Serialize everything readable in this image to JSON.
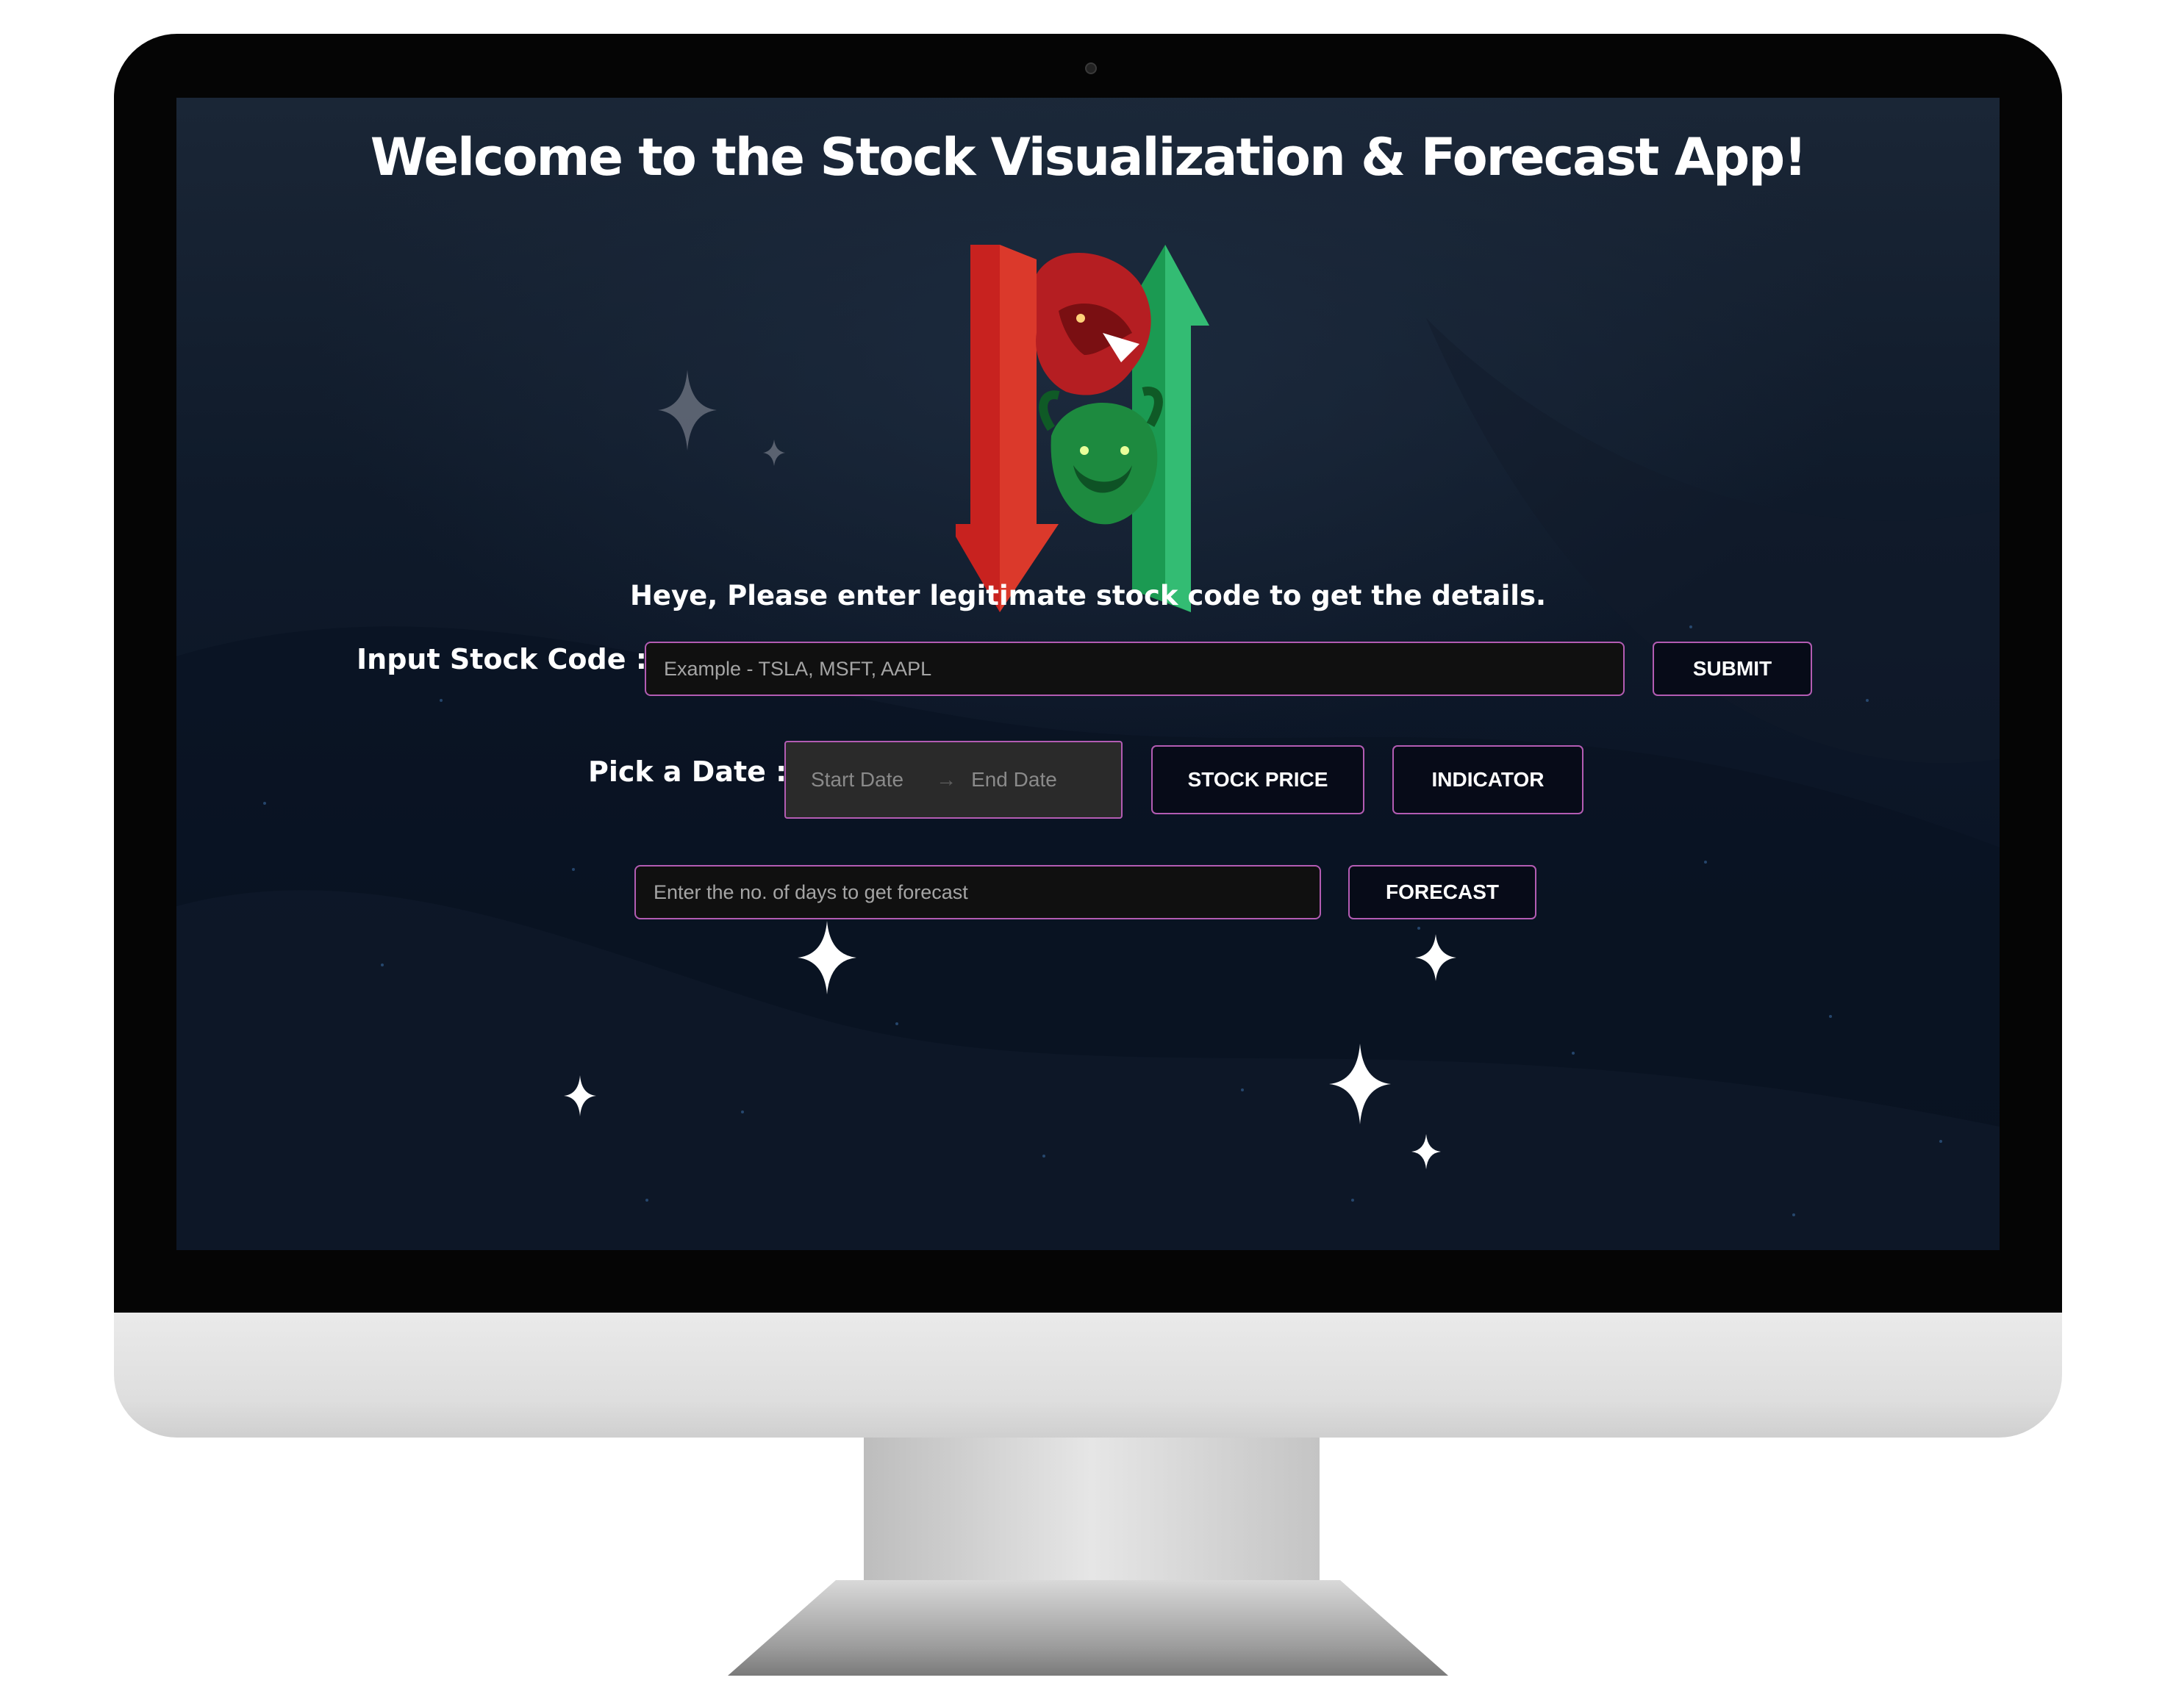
{
  "header": {
    "title": "Welcome to the Stock Visualization & Forecast App!",
    "subtitle": "Heye, Please enter legitimate stock code to get the details."
  },
  "stock_code": {
    "label": "Input Stock Code :",
    "placeholder": "Example - TSLA, MSFT, AAPL",
    "submit_label": "SUBMIT"
  },
  "date_picker": {
    "label": "Pick a Date :",
    "start_placeholder": "Start Date",
    "end_placeholder": "End Date",
    "stock_price_label": "STOCK PRICE",
    "indicator_label": "INDICATOR"
  },
  "forecast": {
    "placeholder": "Enter the no. of days to get forecast",
    "button_label": "FORECAST"
  },
  "theme": {
    "accent_border": "#b35cb3",
    "bear_color": "#d42a25",
    "bull_color": "#1ea35a"
  },
  "icons": [
    "bear-bull-logo-icon",
    "sparkle-star-icon",
    "arrow-right-icon"
  ]
}
